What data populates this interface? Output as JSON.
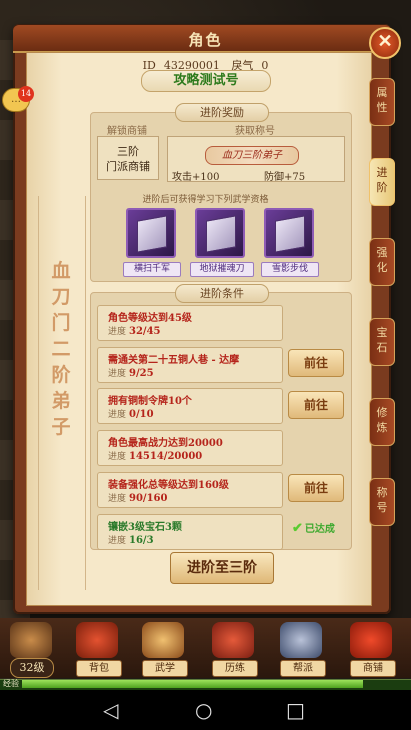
{
  "panel": {
    "title": "角色",
    "close_symbol": "✕"
  },
  "player": {
    "id_label": "ID",
    "id": "43290001",
    "qi_label": "戾气",
    "qi": "0",
    "name": "攻略测试号"
  },
  "rank_title": "血刀门二阶弟子",
  "reward": {
    "section_label": "进阶奖励",
    "shop_header": "解锁商铺",
    "title_header": "获取称号",
    "shop_name": "三阶\n门派商铺",
    "title_badge": "血刀三阶弟子",
    "attack": "攻击+100",
    "defense": "防御+75",
    "skills_hint": "进阶后可获得学习下列武学资格",
    "skills": [
      "横扫千军",
      "地狱摧魂刀",
      "雪影步伐"
    ]
  },
  "conditions_label": "进阶条件",
  "progress_label": "进度",
  "go_label": "前往",
  "done_label": "已达成",
  "conditions": [
    {
      "title": "角色等级达到45级",
      "progress": "32/45"
    },
    {
      "title": "需通关第二十五铜人巷 - 达摩",
      "progress": "9/25"
    },
    {
      "title": "拥有铜制令牌10个",
      "progress": "0/10"
    },
    {
      "title": "角色最高战力达到20000",
      "progress": "14514/20000"
    },
    {
      "title": "装备强化总等级达到160级",
      "progress": "90/160"
    },
    {
      "title": "镶嵌3级宝石3颗",
      "progress": "16/3"
    }
  ],
  "advance_button": "进阶至三阶",
  "side_tabs": [
    "属性",
    "进阶",
    "强化",
    "宝石",
    "修炼",
    "称号"
  ],
  "chat_badge": "14",
  "bottom_nav": {
    "level": "32级",
    "items": [
      "背包",
      "武学",
      "历练",
      "帮派",
      "商铺"
    ],
    "exp_label": "经验",
    "exp_fraction": 0.88
  },
  "colors": {
    "panel": "#7a3b1f",
    "paper": "#f3e3c1",
    "accent_red": "#b5241b",
    "done_green": "#2a7a2a"
  }
}
